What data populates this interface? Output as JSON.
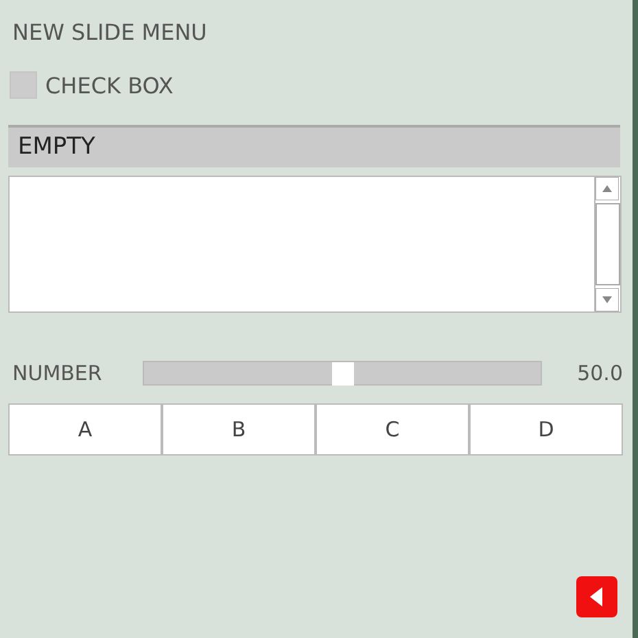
{
  "title": "NEW SLIDE MENU",
  "checkbox": {
    "label": "CHECK BOX",
    "checked": false
  },
  "dropdown": {
    "value": "EMPTY"
  },
  "slider": {
    "label": "NUMBER",
    "level": 0.5,
    "reading": "50.0"
  },
  "buttons": [
    "A",
    "B",
    "C",
    "D"
  ]
}
